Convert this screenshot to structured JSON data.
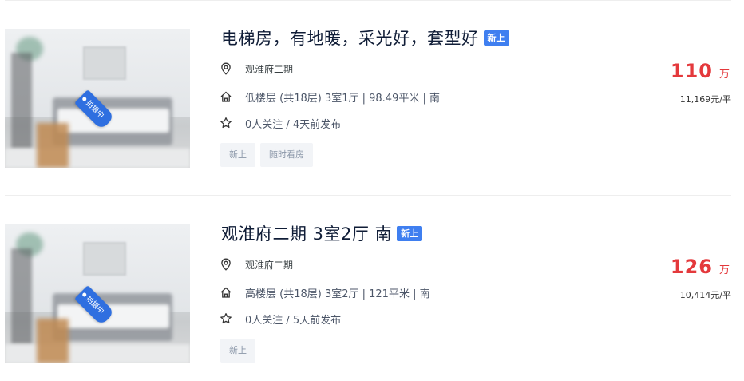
{
  "listings": [
    {
      "title": "电梯房，有地暖，采光好，套型好",
      "badge": "新上",
      "image_tag": "拍摄中",
      "community": "观淮府二期",
      "house_info": "低楼层 (共18层) 3室1厅 | 98.49平米 | 南",
      "follow_info": "0人关注 / 4天前发布",
      "tags": [
        "新上",
        "随时看房"
      ],
      "total_price": "110",
      "total_unit": "万",
      "unit_price": "11,169元/平"
    },
    {
      "title": "观淮府二期 3室2厅 南",
      "badge": "新上",
      "image_tag": "拍摄中",
      "community": "观淮府二期",
      "house_info": "高楼层 (共18层) 3室2厅 | 121平米 | 南",
      "follow_info": "0人关注 / 5天前发布",
      "tags": [
        "新上"
      ],
      "total_price": "126",
      "total_unit": "万",
      "unit_price": "10,414元/平"
    }
  ],
  "icons": {
    "location": "location-pin-icon",
    "house": "house-icon",
    "follow": "star-icon"
  },
  "colors": {
    "price": "#e4393c",
    "badge": "#3f7ff0",
    "title": "#101d37"
  }
}
